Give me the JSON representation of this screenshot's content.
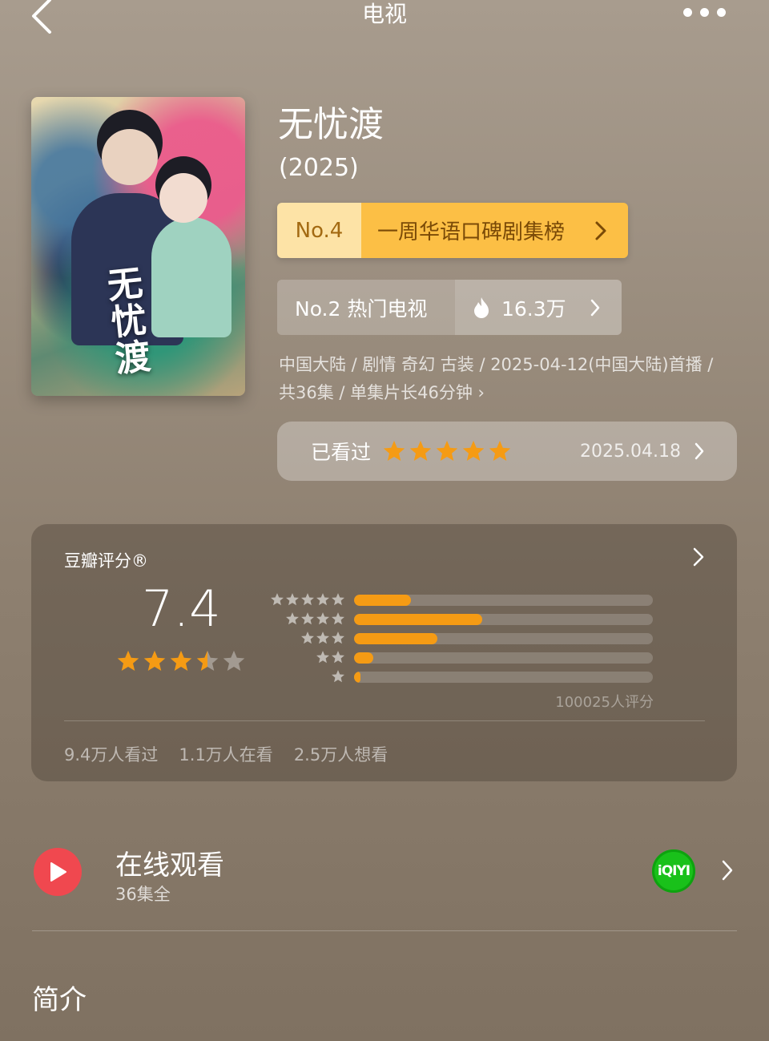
{
  "nav": {
    "title": "电视",
    "back_icon": "chevron-left-icon",
    "more_icon": "more-dots-icon"
  },
  "movie": {
    "title": "无忧渡",
    "year": "(2025)",
    "poster_title": "无忧渡"
  },
  "rank_primary": {
    "number": "No.4",
    "label": "一周华语口碑剧集榜"
  },
  "rank_secondary": {
    "label": "No.2 热门电视",
    "heat": "16.3万"
  },
  "meta": {
    "text": "中国大陆 / 剧情 奇幻 古装 / 2025-04-12(中国大陆)首播 / 共36集 / 单集片长46分钟 ›"
  },
  "watched": {
    "label": "已看过",
    "stars": 5,
    "date": "2025.04.18"
  },
  "douban": {
    "title": "豆瓣评分®",
    "score": "7.4",
    "score_stars": 3.5,
    "distribution": [
      {
        "stars": 5,
        "fraction": 0.19
      },
      {
        "stars": 4,
        "fraction": 0.43
      },
      {
        "stars": 3,
        "fraction": 0.28
      },
      {
        "stars": 2,
        "fraction": 0.065
      },
      {
        "stars": 1,
        "fraction": 0.022
      }
    ],
    "rating_count": "100025人评分",
    "stats": [
      "9.4万人看过",
      "1.1万人在看",
      "2.5万人想看"
    ]
  },
  "watch_online": {
    "title": "在线观看",
    "subtitle": "36集全",
    "platform_logo_text": "iQIYI"
  },
  "intro": {
    "title": "简介"
  },
  "colors": {
    "accent_orange": "#f59b14",
    "rank_gold": "#fcbf45",
    "play_red": "#f0484f",
    "iqiyi_green": "#19c11a"
  }
}
